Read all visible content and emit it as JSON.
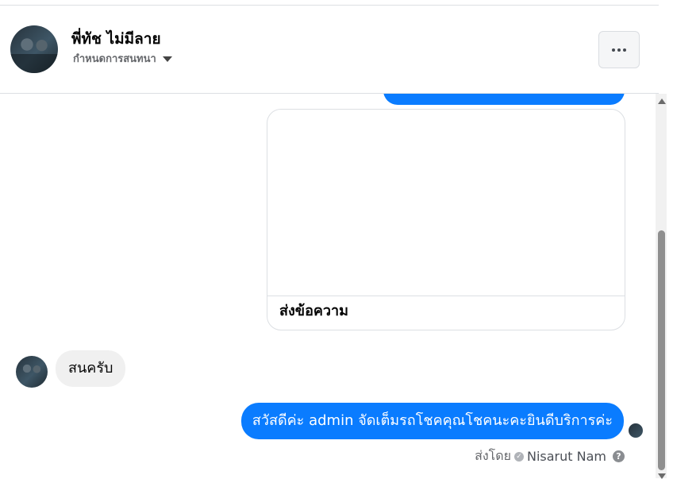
{
  "header": {
    "contact_name": "พี่ทัช ไม่มีลาย",
    "conversation_settings_label": "กำหนดการสนทนา",
    "more_icon": "more-horizontal-icon"
  },
  "messages": {
    "card": {
      "cta_label": "ส่งข้อความ"
    },
    "incoming": {
      "text": "สนครับ"
    },
    "outgoing": {
      "text": "สวัสดีค่ะ admin จัดเต็มรถโชคคุณโชคนะคะยินดีบริการค่ะ",
      "sent_by_label": "ส่งโดย",
      "sender_name": "Nisarut Nam"
    }
  },
  "colors": {
    "accent": "#0a7cff",
    "incoming_bubble": "#f0f0f0",
    "muted_text": "#65676b"
  }
}
